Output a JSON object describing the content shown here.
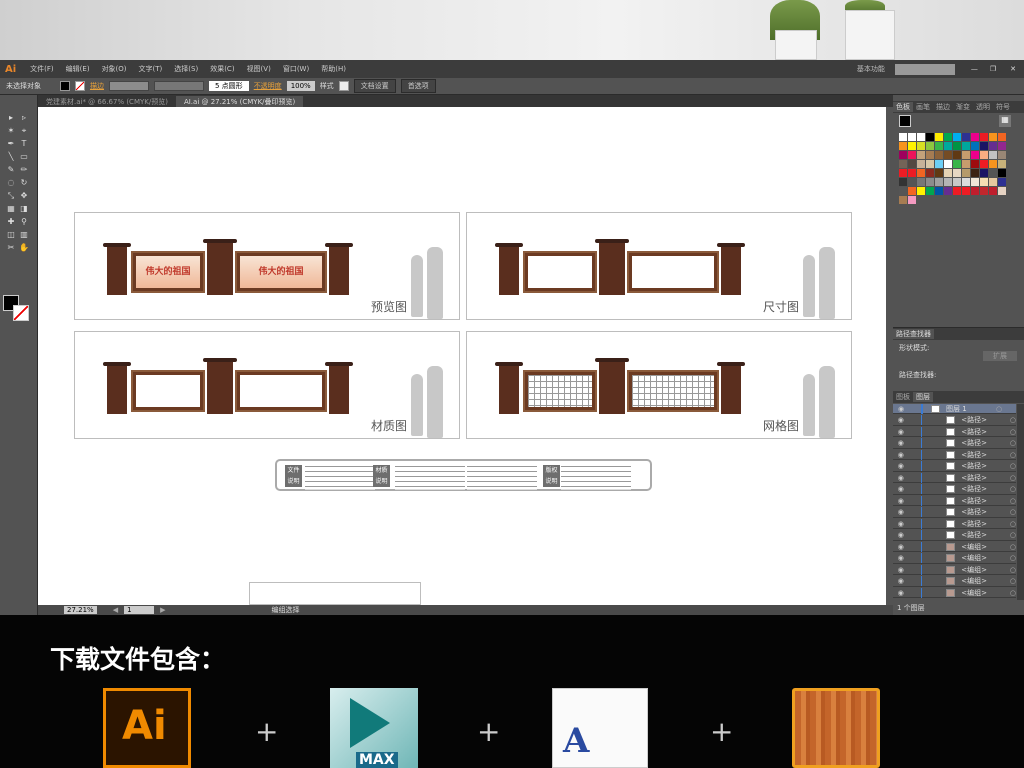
{
  "app": {
    "logo": "Ai",
    "workspace": "基本功能",
    "menu": [
      "文件(F)",
      "编辑(E)",
      "对象(O)",
      "文字(T)",
      "选择(S)",
      "效果(C)",
      "视图(V)",
      "窗口(W)",
      "帮助(H)"
    ]
  },
  "control": {
    "selection": "未选择对象",
    "stroke_label": "描边",
    "brush": "5 点圆形",
    "opacity_label": "不透明度",
    "opacity": "100%",
    "style_label": "样式",
    "doc_setup": "文档设置",
    "prefs": "首选项"
  },
  "tabs": [
    {
      "label": "党建素材.ai* @ 66.67% (CMYK/预览)",
      "active": false
    },
    {
      "label": "AI.ai @ 27.21% (CMYK/叠印预览)",
      "active": true
    }
  ],
  "status": {
    "zoom": "27.21%",
    "page": "1",
    "mode": "编组选择"
  },
  "artboard": {
    "panels": [
      {
        "label": "预览图",
        "style": "poster",
        "title": "伟大的祖国"
      },
      {
        "label": "尺寸图",
        "style": "blank"
      },
      {
        "label": "材质图",
        "style": "blank"
      },
      {
        "label": "网格图",
        "style": "grid"
      }
    ],
    "info": [
      {
        "badge": "文件说明"
      },
      {
        "badge": "材质说明"
      },
      {
        "badge": "版权说明"
      }
    ]
  },
  "right_panel": {
    "swatch_tabs": [
      "色板",
      "画笔",
      "描边",
      "渐变",
      "透明",
      "符号"
    ],
    "swatches": [
      "#ffffff",
      "#ffffff",
      "#ffffff",
      "#000000",
      "#ffec00",
      "#00a650",
      "#00aeef",
      "#2e3192",
      "#ec008c",
      "#ed1c24",
      "#f7941d",
      "#f26522",
      "#f7941d",
      "#fff200",
      "#d7df23",
      "#8dc63f",
      "#39b54a",
      "#00a99d",
      "#009444",
      "#00a79d",
      "#0072bc",
      "#1b1464",
      "#662d91",
      "#92278f",
      "#9e005d",
      "#ed145b",
      "#c4a27a",
      "#a67c52",
      "#8c6239",
      "#754c24",
      "#603913",
      "#c69c6d",
      "#ec008c",
      "#f9ad81",
      "#c1c1c1",
      "#998675",
      "#736357",
      "#534741",
      "#c7b299",
      "#d8c8a8",
      "#6dcff6",
      "#ffffff",
      "#39b54a",
      "#c69c6d",
      "#9e0b0f",
      "#ed1c24",
      "#f7941d",
      "#c8b27a",
      "#ed1c24",
      "#ed1c24",
      "#f26522",
      "#8c2a1f",
      "#603913",
      "#e6d3b3",
      "#e6d7c3",
      "#b59a6a",
      "#3b2314",
      "#1b1464",
      "#555555",
      "#000000",
      "#333333",
      "#555555",
      "#777777",
      "#8c8c8c",
      "#a0a0a0",
      "#b4b4b4",
      "#c8c8c8",
      "#dcdcdc",
      "#f0e6d8",
      "#f5deb3",
      "#e6c8a0",
      "#2e3192",
      "#555555",
      "#f26522",
      "#fff200",
      "#00a650",
      "#0054a6",
      "#662d91",
      "#ed1c24",
      "#ed1c24",
      "#be1e2d",
      "#c1272d",
      "#be1e2d",
      "#e6d3c3",
      "#a67c52",
      "#f49ac1"
    ],
    "pathfinder": {
      "title": "路径查找器",
      "shape_modes": "形状模式:",
      "expand": "扩展",
      "pathfinders": "路径查找器:"
    },
    "layer_tabs": [
      "图板",
      "图层"
    ],
    "layers": [
      {
        "name": "图层 1",
        "type": "layer"
      },
      {
        "name": "<路径>"
      },
      {
        "name": "<路径>"
      },
      {
        "name": "<路径>"
      },
      {
        "name": "<路径>"
      },
      {
        "name": "<路径>"
      },
      {
        "name": "<路径>"
      },
      {
        "name": "<路径>"
      },
      {
        "name": "<路径>"
      },
      {
        "name": "<路径>"
      },
      {
        "name": "<路径>"
      },
      {
        "name": "<路径>"
      },
      {
        "name": "<编组>",
        "group": true
      },
      {
        "name": "<编组>",
        "group": true
      },
      {
        "name": "<编组>",
        "group": true
      },
      {
        "name": "<编组>",
        "group": true
      },
      {
        "name": "<编组>",
        "group": true
      }
    ],
    "layer_count": "1 个图层"
  },
  "promo": {
    "headline": "下载文件包含：",
    "icons": [
      {
        "name": "illustrator-icon",
        "label": "Ai"
      },
      {
        "name": "3ds-max-icon",
        "label": "MAX"
      },
      {
        "name": "font-file-icon",
        "label": "A"
      },
      {
        "name": "wood-texture-icon"
      }
    ],
    "plus": "+"
  }
}
